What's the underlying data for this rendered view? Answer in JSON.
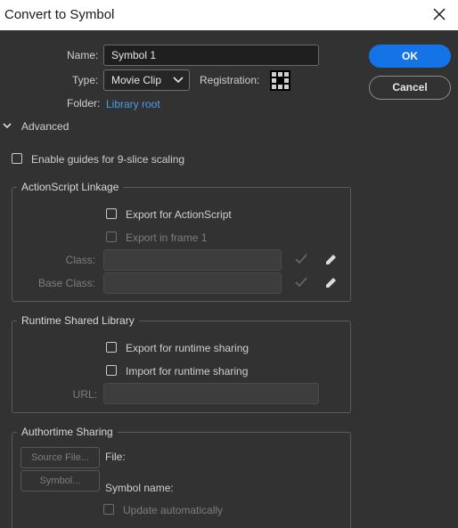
{
  "window": {
    "title": "Convert to Symbol"
  },
  "form": {
    "name_label": "Name:",
    "name_value": "Symbol 1",
    "type_label": "Type:",
    "type_value": "Movie Clip",
    "registration_label": "Registration:",
    "folder_label": "Folder:",
    "folder_value": "Library root"
  },
  "buttons": {
    "ok": "OK",
    "cancel": "Cancel"
  },
  "advanced": {
    "label": "Advanced",
    "enable_guides": "Enable guides for 9-slice scaling"
  },
  "actionscript": {
    "title": "ActionScript Linkage",
    "export_for_as": "Export for ActionScript",
    "export_in_frame": "Export in frame 1",
    "class_label": "Class:",
    "base_class_label": "Base Class:"
  },
  "runtime": {
    "title": "Runtime Shared Library",
    "export_runtime": "Export for runtime sharing",
    "import_runtime": "Import for runtime sharing",
    "url_label": "URL:"
  },
  "authortime": {
    "title": "Authortime Sharing",
    "source_file_button": "Source File...",
    "symbol_button": "Symbol...",
    "file_label": "File:",
    "symbol_name_label": "Symbol name:",
    "update_auto": "Update automatically"
  },
  "icons": {
    "close": "close-icon",
    "chevron": "chevron-down-icon",
    "check": "check-icon",
    "pencil": "pencil-icon"
  },
  "colors": {
    "accent": "#1473e6",
    "link": "#4a9fe8",
    "background": "#323232"
  }
}
